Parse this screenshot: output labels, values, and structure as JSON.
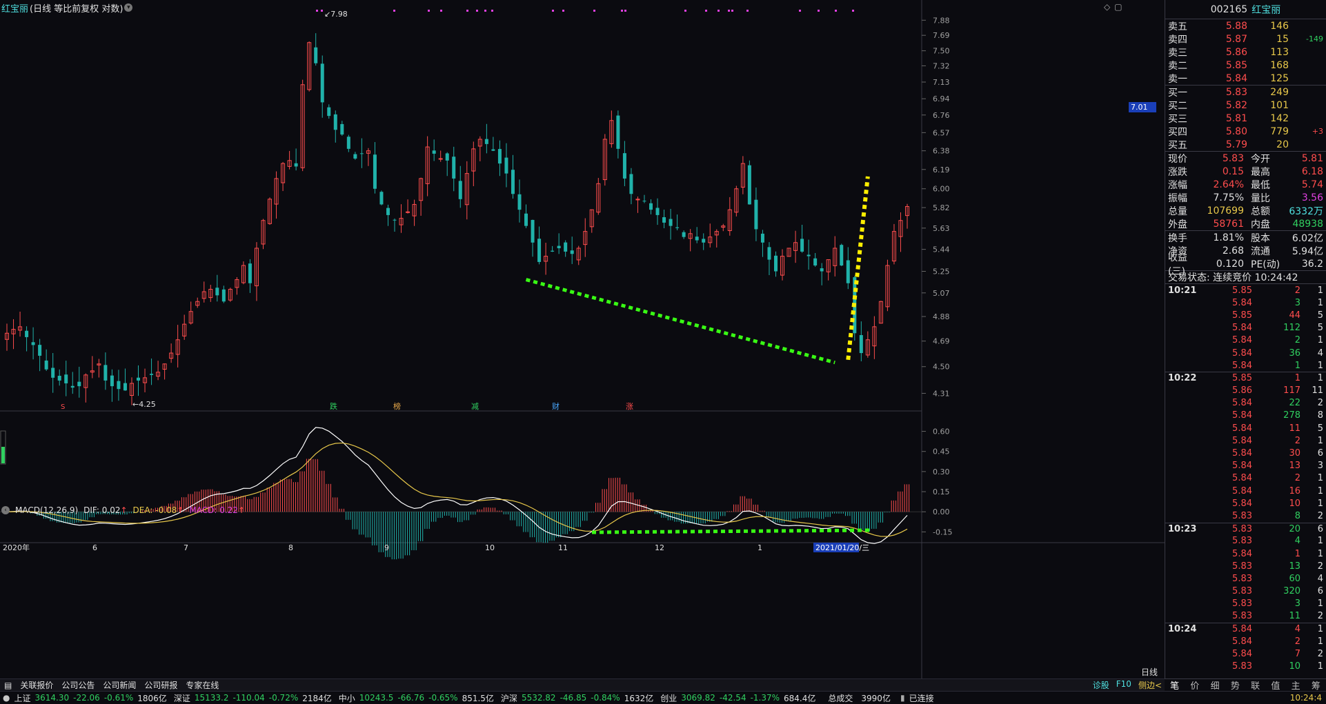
{
  "stock": {
    "code": "002165",
    "name": "红宝丽",
    "mode": "(日线 等比前复权 对数)"
  },
  "colors": {
    "up": "#ff4d4d",
    "down": "#20b2aa",
    "dif": "#ffffff",
    "dea": "#e8c84a",
    "macd": "#e040e0",
    "trend_down": "#39ff14",
    "trend_up": "#ffee00"
  },
  "chart_data": {
    "type": "candlestick",
    "price_axis": {
      "scale": "log",
      "ticks": [
        "7.88",
        "7.69",
        "7.50",
        "7.32",
        "7.13",
        "6.94",
        "6.76",
        "6.57",
        "6.38",
        "6.19",
        "6.00",
        "5.82",
        "5.63",
        "5.44",
        "5.25",
        "5.07",
        "4.88",
        "4.69",
        "4.50",
        "4.31"
      ],
      "current_marker": "7.01"
    },
    "x_axis": {
      "labels": [
        "2020年",
        "6",
        "7",
        "8",
        "9",
        "10",
        "11",
        "12",
        "1",
        "2021/01/20/三"
      ],
      "period": "日线"
    },
    "annotations": {
      "high": "7.98",
      "low": "4.25"
    },
    "events": [
      "跌",
      "榜",
      "减",
      "财",
      "涨"
    ],
    "price_path": [
      4.75,
      4.78,
      4.8,
      4.72,
      4.66,
      4.58,
      4.48,
      4.42,
      4.4,
      4.38,
      4.35,
      4.36,
      4.44,
      4.47,
      4.52,
      4.4,
      4.36,
      4.34,
      4.33,
      4.38,
      4.4,
      4.42,
      4.44,
      4.46,
      4.52,
      4.6,
      4.7,
      4.82,
      4.92,
      5.0,
      5.08,
      5.1,
      5.05,
      5.0,
      5.1,
      5.18,
      5.3,
      5.15,
      5.45,
      5.7,
      5.9,
      6.1,
      6.25,
      6.28,
      6.22,
      7.1,
      7.6,
      7.35,
      6.9,
      6.75,
      6.6,
      6.55,
      6.4,
      6.3,
      6.35,
      6.38,
      6.0,
      5.85,
      5.75,
      5.7,
      5.72,
      5.78,
      5.85,
      6.1,
      6.42,
      6.35,
      6.3,
      6.28,
      6.1,
      5.9,
      6.15,
      6.4,
      6.5,
      6.45,
      6.38,
      6.25,
      6.15,
      5.95,
      5.8,
      5.65,
      5.5,
      5.33,
      5.38,
      5.42,
      5.45,
      5.42,
      5.4,
      5.45,
      5.6,
      5.8,
      6.05,
      6.5,
      6.7,
      6.4,
      6.1,
      5.95,
      5.9,
      5.88,
      5.8,
      5.75,
      5.68,
      5.65,
      5.63,
      5.55,
      5.58,
      5.52,
      5.5,
      5.55,
      5.6,
      5.65,
      5.8,
      6.0,
      6.25,
      5.85,
      5.62,
      5.5,
      5.35,
      5.25,
      5.38,
      5.45,
      5.5,
      5.42,
      5.38,
      5.3,
      5.25,
      5.35,
      5.45,
      5.3,
      5.15,
      4.75,
      4.6,
      4.7,
      4.8,
      5.0,
      5.3,
      5.6,
      5.7,
      5.83
    ],
    "macd_axis": {
      "ticks": [
        "0.60",
        "0.45",
        "0.30",
        "0.15",
        "0.00",
        "-0.15"
      ]
    },
    "macd_params": "MACD(12,26,9)",
    "dif": "0.02",
    "dea": "-0.08",
    "macd": "0.22"
  },
  "labels": {
    "dif": "DIF:",
    "dea": "DEA:",
    "macd": "MACD:",
    "up_arrow": "↑"
  },
  "news_bar": {
    "items": [
      "关联报价",
      "公司公告",
      "公司新闻",
      "公司研报",
      "专家在线"
    ],
    "right": [
      "诊股",
      "F10",
      "侧边<"
    ]
  },
  "status_bar": [
    {
      "name": "上证",
      "price": "3614.30",
      "chg": "-22.06",
      "pct": "-0.61%",
      "amt": "1806亿"
    },
    {
      "name": "深证",
      "price": "15133.2",
      "chg": "-110.04",
      "pct": "-0.72%",
      "amt": "2184亿"
    },
    {
      "name": "中小",
      "price": "10243.5",
      "chg": "-66.76",
      "pct": "-0.65%",
      "amt": "851.5亿"
    },
    {
      "name": "沪深",
      "price": "5532.82",
      "chg": "-46.85",
      "pct": "-0.84%",
      "amt": "1632亿"
    },
    {
      "name": "创业",
      "price": "3069.82",
      "chg": "-42.54",
      "pct": "-1.37%",
      "amt": "684.4亿"
    }
  ],
  "status_extra": {
    "total_label": "总成交",
    "total": "3990亿",
    "conn": "已连接",
    "time": "10:24:4"
  },
  "order_book": {
    "asks": [
      {
        "label": "卖五",
        "price": "5.88",
        "vol": "146",
        "chg": ""
      },
      {
        "label": "卖四",
        "price": "5.87",
        "vol": "15",
        "chg": "-149"
      },
      {
        "label": "卖三",
        "price": "5.86",
        "vol": "113",
        "chg": ""
      },
      {
        "label": "卖二",
        "price": "5.85",
        "vol": "168",
        "chg": ""
      },
      {
        "label": "卖一",
        "price": "5.84",
        "vol": "125",
        "chg": ""
      }
    ],
    "bids": [
      {
        "label": "买一",
        "price": "5.83",
        "vol": "249",
        "chg": ""
      },
      {
        "label": "买二",
        "price": "5.82",
        "vol": "101",
        "chg": ""
      },
      {
        "label": "买三",
        "price": "5.81",
        "vol": "142",
        "chg": ""
      },
      {
        "label": "买四",
        "price": "5.80",
        "vol": "779",
        "chg": "+3"
      },
      {
        "label": "买五",
        "price": "5.79",
        "vol": "20",
        "chg": ""
      }
    ]
  },
  "stats": [
    {
      "l1": "现价",
      "v1": "5.83",
      "c1": "#ff4d4d",
      "l2": "今开",
      "v2": "5.81",
      "c2": "#ff4d4d"
    },
    {
      "l1": "涨跌",
      "v1": "0.15",
      "c1": "#ff4d4d",
      "l2": "最高",
      "v2": "6.18",
      "c2": "#ff4d4d"
    },
    {
      "l1": "涨幅",
      "v1": "2.64%",
      "c1": "#ff4d4d",
      "l2": "最低",
      "v2": "5.74",
      "c2": "#ff4d4d"
    },
    {
      "l1": "振幅",
      "v1": "7.75%",
      "c1": "#e0e0e0",
      "l2": "量比",
      "v2": "3.56",
      "c2": "#e040e0"
    },
    {
      "l1": "总量",
      "v1": "107699",
      "c1": "#e8c84a",
      "l2": "总额",
      "v2": "6332万",
      "c2": "#4fe0e0"
    },
    {
      "l1": "外盘",
      "v1": "58761",
      "c1": "#ff4d4d",
      "l2": "内盘",
      "v2": "48938",
      "c2": "#30d060"
    }
  ],
  "stats2": [
    {
      "l1": "换手",
      "v1": "1.81%",
      "l2": "股本",
      "v2": "6.02亿"
    },
    {
      "l1": "净资",
      "v1": "2.68",
      "l2": "流通",
      "v2": "5.94亿"
    },
    {
      "l1": "收益(三)",
      "v1": "0.120",
      "l2": "PE(动)",
      "v2": "36.2"
    }
  ],
  "trade_state": "交易状态: 连续竞价 10:24:42",
  "ticks": [
    {
      "time": "10:21",
      "price": "5.85",
      "vol": "2",
      "cnt": "1",
      "pc": "#ff4d4d",
      "vc": "#ff4d4d",
      "sep": false
    },
    {
      "time": "",
      "price": "5.84",
      "vol": "3",
      "cnt": "1",
      "pc": "#ff4d4d",
      "vc": "#30d060",
      "sep": false
    },
    {
      "time": "",
      "price": "5.85",
      "vol": "44",
      "cnt": "5",
      "pc": "#ff4d4d",
      "vc": "#ff4d4d",
      "sep": false
    },
    {
      "time": "",
      "price": "5.84",
      "vol": "112",
      "cnt": "5",
      "pc": "#ff4d4d",
      "vc": "#30d060",
      "sep": false
    },
    {
      "time": "",
      "price": "5.84",
      "vol": "2",
      "cnt": "1",
      "pc": "#ff4d4d",
      "vc": "#30d060",
      "sep": false
    },
    {
      "time": "",
      "price": "5.84",
      "vol": "36",
      "cnt": "4",
      "pc": "#ff4d4d",
      "vc": "#30d060",
      "sep": false
    },
    {
      "time": "",
      "price": "5.84",
      "vol": "1",
      "cnt": "1",
      "pc": "#ff4d4d",
      "vc": "#30d060",
      "sep": false
    },
    {
      "time": "10:22",
      "price": "5.85",
      "vol": "1",
      "cnt": "1",
      "pc": "#ff4d4d",
      "vc": "#ff4d4d",
      "sep": true
    },
    {
      "time": "",
      "price": "5.86",
      "vol": "117",
      "cnt": "11",
      "pc": "#ff4d4d",
      "vc": "#ff4d4d",
      "sep": false
    },
    {
      "time": "",
      "price": "5.84",
      "vol": "22",
      "cnt": "2",
      "pc": "#ff4d4d",
      "vc": "#30d060",
      "sep": false
    },
    {
      "time": "",
      "price": "5.84",
      "vol": "278",
      "cnt": "8",
      "pc": "#ff4d4d",
      "vc": "#30d060",
      "sep": false
    },
    {
      "time": "",
      "price": "5.84",
      "vol": "11",
      "cnt": "5",
      "pc": "#ff4d4d",
      "vc": "#ff4d4d",
      "sep": false
    },
    {
      "time": "",
      "price": "5.84",
      "vol": "2",
      "cnt": "1",
      "pc": "#ff4d4d",
      "vc": "#ff4d4d",
      "sep": false
    },
    {
      "time": "",
      "price": "5.84",
      "vol": "30",
      "cnt": "6",
      "pc": "#ff4d4d",
      "vc": "#ff4d4d",
      "sep": false
    },
    {
      "time": "",
      "price": "5.84",
      "vol": "13",
      "cnt": "3",
      "pc": "#ff4d4d",
      "vc": "#ff4d4d",
      "sep": false
    },
    {
      "time": "",
      "price": "5.84",
      "vol": "2",
      "cnt": "1",
      "pc": "#ff4d4d",
      "vc": "#ff4d4d",
      "sep": false
    },
    {
      "time": "",
      "price": "5.84",
      "vol": "16",
      "cnt": "1",
      "pc": "#ff4d4d",
      "vc": "#ff4d4d",
      "sep": false
    },
    {
      "time": "",
      "price": "5.84",
      "vol": "10",
      "cnt": "1",
      "pc": "#ff4d4d",
      "vc": "#ff4d4d",
      "sep": false
    },
    {
      "time": "",
      "price": "5.83",
      "vol": "8",
      "cnt": "2",
      "pc": "#ff4d4d",
      "vc": "#30d060",
      "sep": false
    },
    {
      "time": "10:23",
      "price": "5.83",
      "vol": "20",
      "cnt": "6",
      "pc": "#ff4d4d",
      "vc": "#30d060",
      "sep": true
    },
    {
      "time": "",
      "price": "5.83",
      "vol": "4",
      "cnt": "1",
      "pc": "#ff4d4d",
      "vc": "#30d060",
      "sep": false
    },
    {
      "time": "",
      "price": "5.84",
      "vol": "1",
      "cnt": "1",
      "pc": "#ff4d4d",
      "vc": "#ff4d4d",
      "sep": false
    },
    {
      "time": "",
      "price": "5.83",
      "vol": "13",
      "cnt": "2",
      "pc": "#ff4d4d",
      "vc": "#30d060",
      "sep": false
    },
    {
      "time": "",
      "price": "5.83",
      "vol": "60",
      "cnt": "4",
      "pc": "#ff4d4d",
      "vc": "#30d060",
      "sep": false
    },
    {
      "time": "",
      "price": "5.83",
      "vol": "320",
      "cnt": "6",
      "pc": "#ff4d4d",
      "vc": "#30d060",
      "sep": false
    },
    {
      "time": "",
      "price": "5.83",
      "vol": "3",
      "cnt": "1",
      "pc": "#ff4d4d",
      "vc": "#30d060",
      "sep": false
    },
    {
      "time": "",
      "price": "5.83",
      "vol": "11",
      "cnt": "2",
      "pc": "#ff4d4d",
      "vc": "#30d060",
      "sep": false
    },
    {
      "time": "10:24",
      "price": "5.84",
      "vol": "4",
      "cnt": "1",
      "pc": "#ff4d4d",
      "vc": "#ff4d4d",
      "sep": true
    },
    {
      "time": "",
      "price": "5.84",
      "vol": "2",
      "cnt": "1",
      "pc": "#ff4d4d",
      "vc": "#ff4d4d",
      "sep": false
    },
    {
      "time": "",
      "price": "5.84",
      "vol": "7",
      "cnt": "2",
      "pc": "#ff4d4d",
      "vc": "#ff4d4d",
      "sep": false
    },
    {
      "time": "",
      "price": "5.83",
      "vol": "10",
      "cnt": "1",
      "pc": "#ff4d4d",
      "vc": "#30d060",
      "sep": false
    }
  ],
  "side_tabs": [
    "笔",
    "价",
    "细",
    "势",
    "联",
    "值",
    "主",
    "筹"
  ]
}
